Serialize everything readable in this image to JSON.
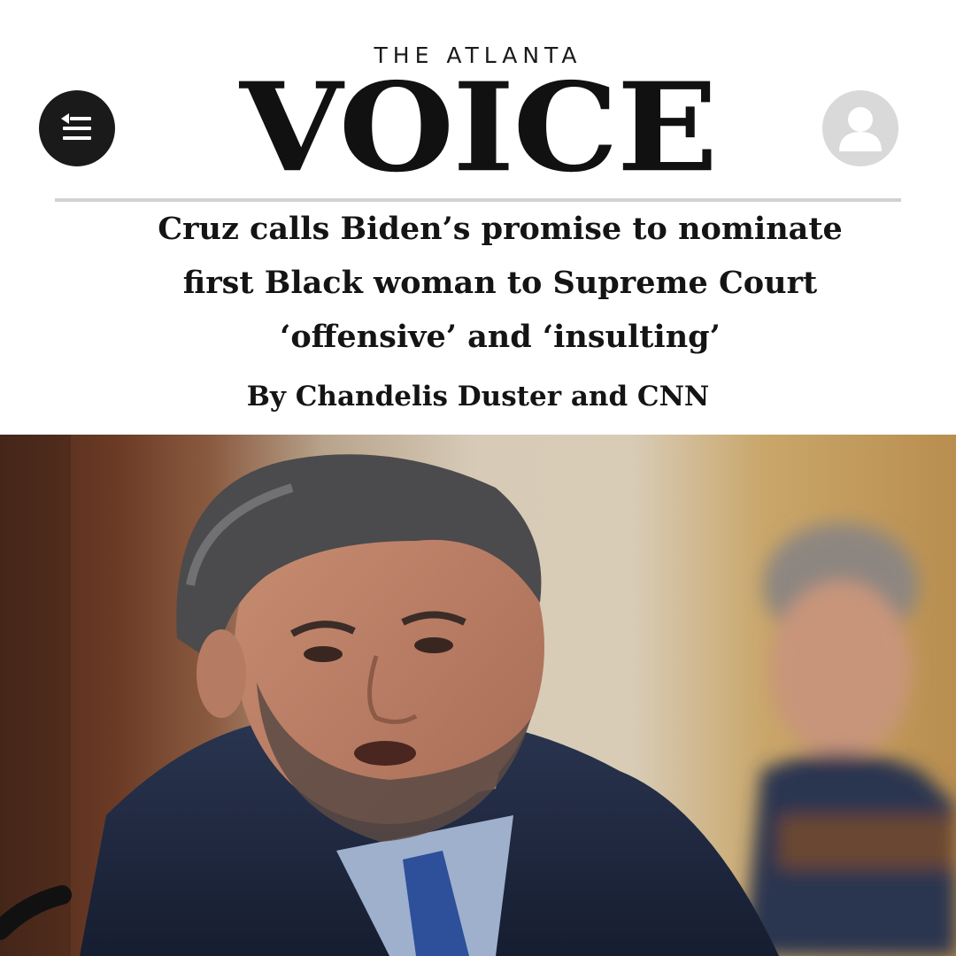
{
  "header": {
    "masthead_top": "THE ATLANTA",
    "masthead_main": "VOICE",
    "menu_icon": "menu-arrow-icon",
    "account_icon": "user-icon"
  },
  "article": {
    "headline_line1": "Cruz calls Biden’s promise to nominate",
    "headline_line2": "first Black woman to Supreme Court",
    "headline_line3": "‘offensive’ and ‘insulting’",
    "byline": "By Chandelis Duster and CNN"
  },
  "colors": {
    "text": "#141414",
    "menu_button": "#1a1a1a",
    "account_button": "#d9d9d9",
    "rule": "#d2d2d2"
  }
}
